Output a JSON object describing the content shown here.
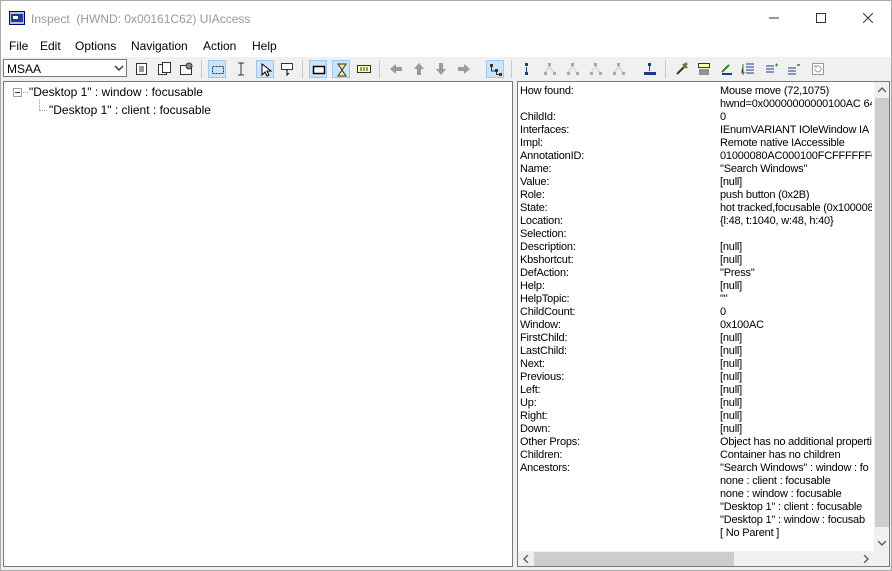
{
  "window": {
    "app_name": "Inspect",
    "title_detail": "(HWND: 0x00161C62) UIAccess"
  },
  "menu": [
    "File",
    "Edit",
    "Options",
    "Navigation",
    "Action",
    "Help"
  ],
  "toolbar": {
    "mode_value": "MSAA",
    "icons": [
      "copy-icon",
      "clipboard-icon",
      "settings-icon",
      "rectangle-select-icon",
      "text-cursor-icon",
      "pointer-icon",
      "watch-cursor-icon",
      "highlight-rectangle-icon",
      "hourglass-icon",
      "caret-icon",
      "arrow-left-icon",
      "arrow-up-icon",
      "arrow-down-icon",
      "arrow-right-icon",
      "tree-view-icon",
      "navigate-parent-icon",
      "navigate-first-child-icon",
      "navigate-prev-icon",
      "navigate-next-icon",
      "navigate-last-child-icon",
      "navigate-child-icon",
      "default-action-icon",
      "select-icon",
      "focus-icon",
      "extend-select-icon",
      "add-select-icon",
      "remove-select-icon",
      "refresh-icon"
    ]
  },
  "tree": [
    {
      "label": "\"Desktop 1\" : window : focusable"
    },
    {
      "label": "\"Desktop 1\" : client : focusable"
    }
  ],
  "properties": [
    {
      "key": "How found:",
      "value": "Mouse move (72,1075)"
    },
    {
      "key": "",
      "value": "hwnd=0x00000000000100AC 64"
    },
    {
      "key": "ChildId:",
      "value": "0"
    },
    {
      "key": "Interfaces:",
      "value": "IEnumVARIANT IOleWindow IA"
    },
    {
      "key": "Impl:",
      "value": "Remote native IAccessible"
    },
    {
      "key": "AnnotationID:",
      "value": "01000080AC000100FCFFFFFF0"
    },
    {
      "key": "Name:",
      "value": "\"Search Windows\""
    },
    {
      "key": "Value:",
      "value": "[null]"
    },
    {
      "key": "Role:",
      "value": "push button (0x2B)"
    },
    {
      "key": "State:",
      "value": "hot tracked,focusable (0x100008"
    },
    {
      "key": "Location:",
      "value": "{l:48, t:1040, w:48, h:40}"
    },
    {
      "key": "Selection:",
      "value": ""
    },
    {
      "key": "Description:",
      "value": "[null]"
    },
    {
      "key": "Kbshortcut:",
      "value": "[null]"
    },
    {
      "key": "DefAction:",
      "value": "\"Press\""
    },
    {
      "key": "Help:",
      "value": "[null]"
    },
    {
      "key": "HelpTopic:",
      "value": "\"\""
    },
    {
      "key": "ChildCount:",
      "value": "0"
    },
    {
      "key": "Window:",
      "value": "0x100AC"
    },
    {
      "key": "FirstChild:",
      "value": "[null]"
    },
    {
      "key": "LastChild:",
      "value": "[null]"
    },
    {
      "key": "Next:",
      "value": "[null]"
    },
    {
      "key": "Previous:",
      "value": "[null]"
    },
    {
      "key": "Left:",
      "value": "[null]"
    },
    {
      "key": "Up:",
      "value": "[null]"
    },
    {
      "key": "Right:",
      "value": "[null]"
    },
    {
      "key": "Down:",
      "value": "[null]"
    },
    {
      "key": "Other Props:",
      "value": "Object has no additional properti"
    },
    {
      "key": "Children:",
      "value": "Container has no children"
    },
    {
      "key": "Ancestors:",
      "value": "\"Search Windows\" : window : fo"
    },
    {
      "key": "",
      "value": "none : client : focusable"
    },
    {
      "key": "",
      "value": "none : window : focusable"
    },
    {
      "key": "",
      "value": "\"Desktop 1\" : client : focusable"
    },
    {
      "key": "",
      "value": "\"Desktop 1\" : window : focusab"
    },
    {
      "key": "",
      "value": "[ No Parent ]"
    }
  ]
}
